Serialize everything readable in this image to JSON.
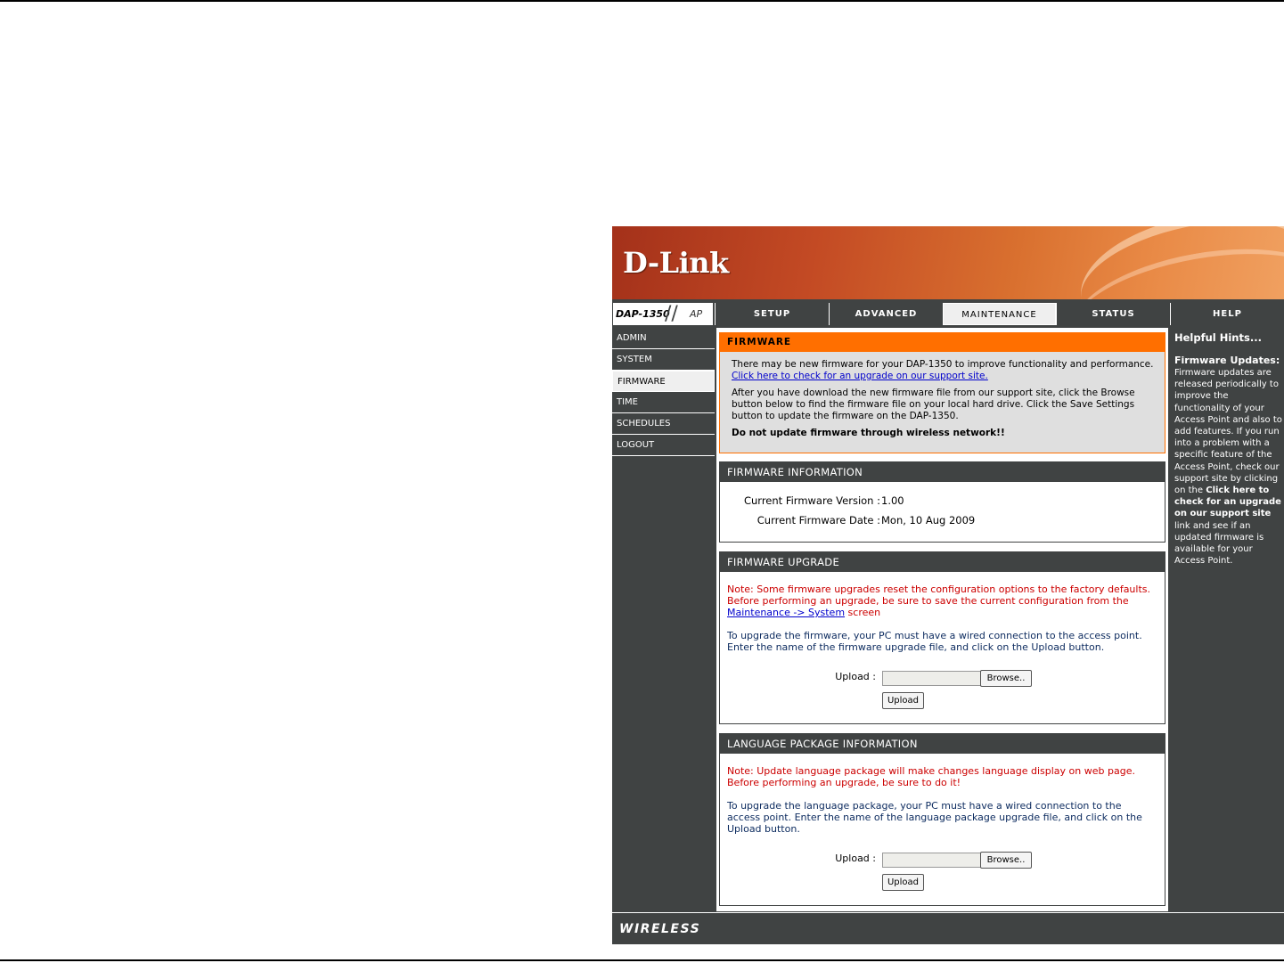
{
  "brand": {
    "logo_text": "D-Link"
  },
  "model": {
    "name": "DAP-1350",
    "mode": "AP"
  },
  "nav": {
    "tabs": [
      "SETUP",
      "ADVANCED",
      "MAINTENANCE",
      "STATUS",
      "HELP"
    ],
    "active": "MAINTENANCE"
  },
  "left_menu": {
    "items": [
      "ADMIN",
      "SYSTEM",
      "FIRMWARE",
      "TIME",
      "SCHEDULES",
      "LOGOUT"
    ],
    "active": "FIRMWARE"
  },
  "firmware": {
    "title": "FIRMWARE",
    "intro": "There may be new firmware for your DAP-1350 to improve functionality and performance.",
    "check_link": "Click here to check for an upgrade on our support site.",
    "instructions": "After you have download the new firmware file from our support site, click the Browse button below to find the firmware file on your local hard drive. Click the Save Settings button to update the firmware on the DAP-1350.",
    "warning": "Do not update firmware through wireless network!!"
  },
  "firmware_info": {
    "title": "FIRMWARE INFORMATION",
    "version_label": "Current Firmware Version :",
    "version_value": "1.00",
    "date_label": "Current Firmware Date :",
    "date_value": "Mon, 10 Aug 2009"
  },
  "firmware_upgrade": {
    "title": "FIRMWARE UPGRADE",
    "note_before_link": "Note: Some firmware upgrades reset the configuration options to the factory defaults. Before performing an upgrade, be sure to save the current configuration from the",
    "note_link": "Maintenance -> System",
    "note_after_link": "screen",
    "instructions": "To upgrade the firmware, your PC must have a wired connection to the access point. Enter the name of the firmware upgrade file, and click on the Upload button.",
    "upload_label": "Upload :",
    "browse_label": "Browse..",
    "upload_button": "Upload"
  },
  "language_package": {
    "title": "LANGUAGE PACKAGE INFORMATION",
    "note": "Note: Update language package will make changes language display on web page. Before performing an upgrade, be sure to do it!",
    "instructions": "To upgrade the language package, your PC must have a wired connection to the access point. Enter the name of the language package upgrade file, and click on the Upload button.",
    "upload_label": "Upload :",
    "browse_label": "Browse..",
    "upload_button": "Upload"
  },
  "help": {
    "title": "Helpful Hints...",
    "subtitle": "Firmware Updates:",
    "text_1": "Firmware updates are released periodically to improve the functionality of your Access Point and also to add features. If you run into a problem with a specific feature of the Access Point, check our support site by clicking on the",
    "text_bold": "Click here to check for an upgrade on our support site",
    "text_2": "link and see if an updated firmware is available for your Access Point."
  },
  "footer": {
    "text": "WIRELESS"
  },
  "colors": {
    "accent": "#ff6f00",
    "panel": "#404343",
    "note_red": "#cc0000",
    "link_blue": "#0000cc"
  }
}
